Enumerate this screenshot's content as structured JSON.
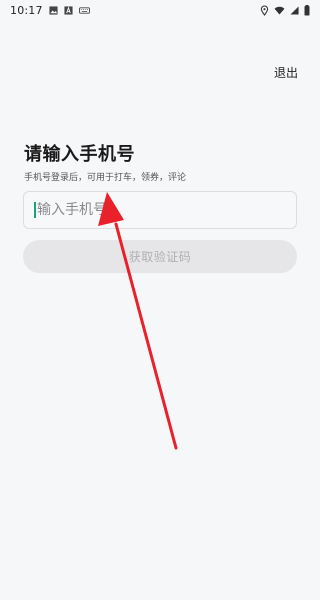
{
  "status_bar": {
    "time": "10:17",
    "left_icons": [
      "image-icon",
      "a-icon",
      "keyboard-icon"
    ],
    "right_icons": [
      "location-icon",
      "wifi-icon",
      "signal-icon",
      "battery-icon"
    ]
  },
  "header": {
    "exit_label": "退出"
  },
  "login": {
    "title": "请输入手机号",
    "subtitle": "手机号登录后，可用于打车，领券，评论",
    "phone_placeholder": "输入手机号",
    "phone_value": "",
    "get_code_label": "获取验证码"
  },
  "annotation": {
    "arrow_color": "#e8212b"
  }
}
